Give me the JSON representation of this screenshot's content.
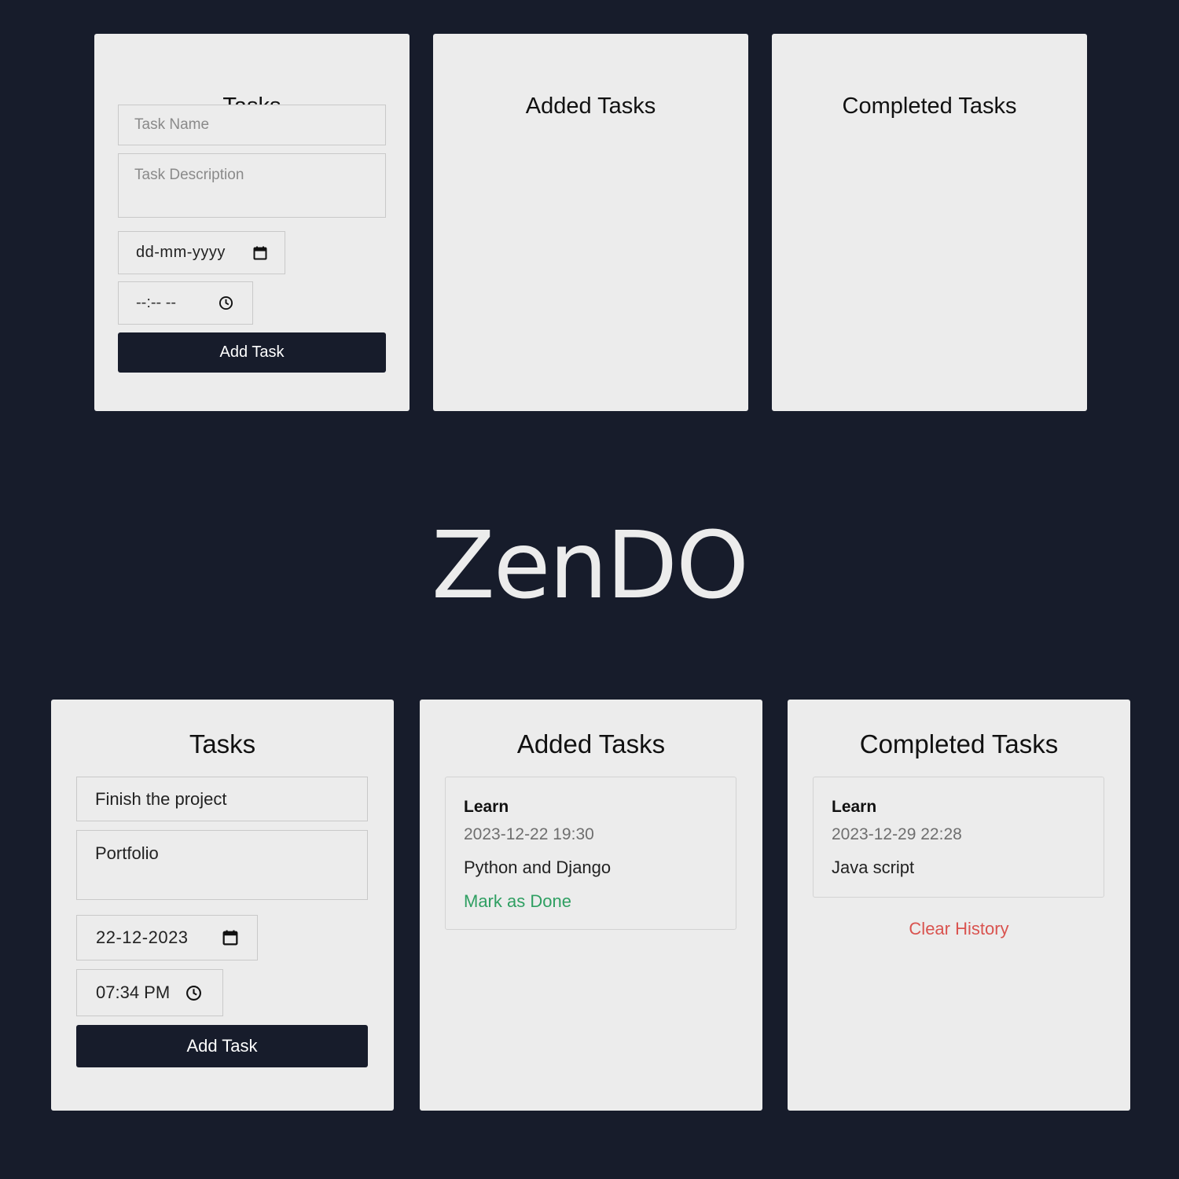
{
  "logo": {
    "text": "ZenDO"
  },
  "colors": {
    "page_background": "#171c2b",
    "panel_background": "#ececec",
    "button_background": "#171c2b",
    "mark_done": "#2f9f62",
    "clear_history": "#d9534f"
  },
  "top": {
    "tasks_panel": {
      "title": "Tasks",
      "task_name_placeholder": "Task Name",
      "task_description_placeholder": "Task Description",
      "date_value": "dd-mm-yyyy",
      "time_value": "--:-- --",
      "add_button_label": "Add Task"
    },
    "added_panel": {
      "title": "Added Tasks"
    },
    "completed_panel": {
      "title": "Completed Tasks"
    }
  },
  "bottom": {
    "tasks_panel": {
      "title": "Tasks",
      "task_name_value": "Finish the project",
      "task_description_value": "Portfolio",
      "date_value": "22-12-2023",
      "time_value": "07:34 PM",
      "add_button_label": "Add Task"
    },
    "added_panel": {
      "title": "Added Tasks",
      "items": [
        {
          "title": "Learn",
          "datetime": "2023-12-22 19:30",
          "description": "Python and Django",
          "action_label": "Mark as Done"
        }
      ]
    },
    "completed_panel": {
      "title": "Completed Tasks",
      "items": [
        {
          "title": "Learn",
          "datetime": "2023-12-29 22:28",
          "description": "Java script"
        }
      ],
      "clear_label": "Clear History"
    }
  },
  "icons": {
    "date": "calendar-icon",
    "time": "clock-icon"
  }
}
